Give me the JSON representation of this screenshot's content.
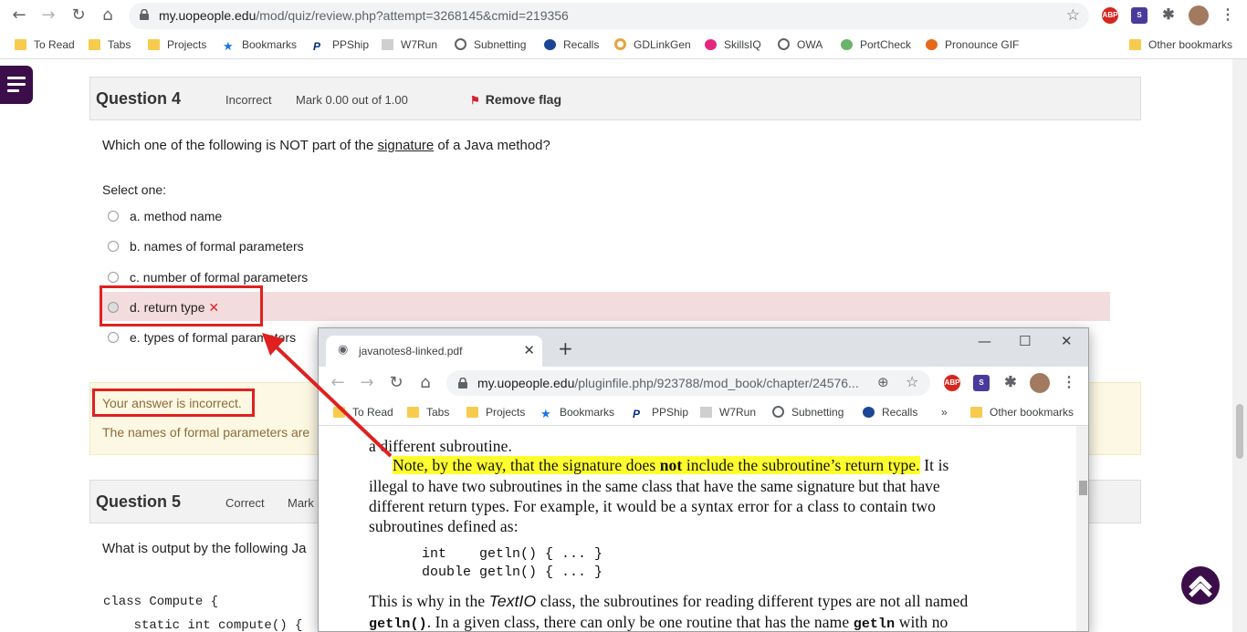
{
  "browser": {
    "url_host": "my.uopeople.edu",
    "url_path": "/mod/quiz/review.php?attempt=3268145&cmid=219356",
    "bookmarks": [
      "To Read",
      "Tabs",
      "Projects",
      "Bookmarks",
      "PPShip",
      "W7Run",
      "Subnetting",
      "Recalls",
      "GDLinkGen",
      "SkillsIQ",
      "OWA",
      "PortCheck",
      "Pronounce GIF"
    ],
    "other_bookmarks": "Other bookmarks",
    "ext_abp": "ABP"
  },
  "quiz": {
    "q4": {
      "title": "Question 4",
      "state": "Incorrect",
      "mark": "Mark 0.00 out of 1.00",
      "flag": "Remove flag",
      "text_before": "Which one of the following is NOT part of the ",
      "text_link": "signature",
      "text_after": " of a Java method?",
      "select_one": "Select one:",
      "options": [
        "a. method name",
        "b. names of formal parameters",
        "c. number of formal parameters",
        "d. return type",
        "e. types of formal parameters"
      ],
      "wrong_mark": "✕",
      "feedback": "Your answer is incorrect.",
      "explanation": "The names of formal parameters are"
    },
    "q5": {
      "title": "Question 5",
      "state": "Correct",
      "mark": "Mark",
      "text": "What is output by the following Ja",
      "code": [
        "class Compute {",
        "    static int compute() {"
      ]
    }
  },
  "popup": {
    "tab_title": "javanotes8-linked.pdf",
    "url_host": "my.uopeople.edu",
    "url_path": "/pluginfile.php/923788/mod_book/chapter/24576...",
    "bookmarks": [
      "To Read",
      "Tabs",
      "Projects",
      "Bookmarks",
      "PPShip",
      "W7Run",
      "Subnetting",
      "Recalls"
    ],
    "more": "»",
    "other_bookmarks": "Other bookmarks",
    "pdf": {
      "line0": "a different subroutine.",
      "hl_a": "Note, by the way, that the signature does ",
      "hl_bold": "not",
      "hl_b": " include the subroutine’s return type.",
      "line1_rest": " It is",
      "line2": "illegal to have two subroutines in the same class that have the same signature but that have",
      "line3": "different return types.  For example, it would be a syntax error for a class to contain two",
      "line4": "subroutines defined as:",
      "code1": "int    getln() { ... }",
      "code2": "double getln() { ... }",
      "line5a": "This is why in the ",
      "line5b": "TextIO",
      "line5c": " class, the subroutines for reading different types are not all named",
      "line6a": "getln()",
      "line6b": ".  In a given class, there can only be one routine that has the name ",
      "line6c": "getln",
      "line6d": " with no"
    }
  },
  "colors": {
    "accent": "#3b0e4a",
    "annotation_red": "#e02020",
    "highlight": "#ffff2e"
  }
}
